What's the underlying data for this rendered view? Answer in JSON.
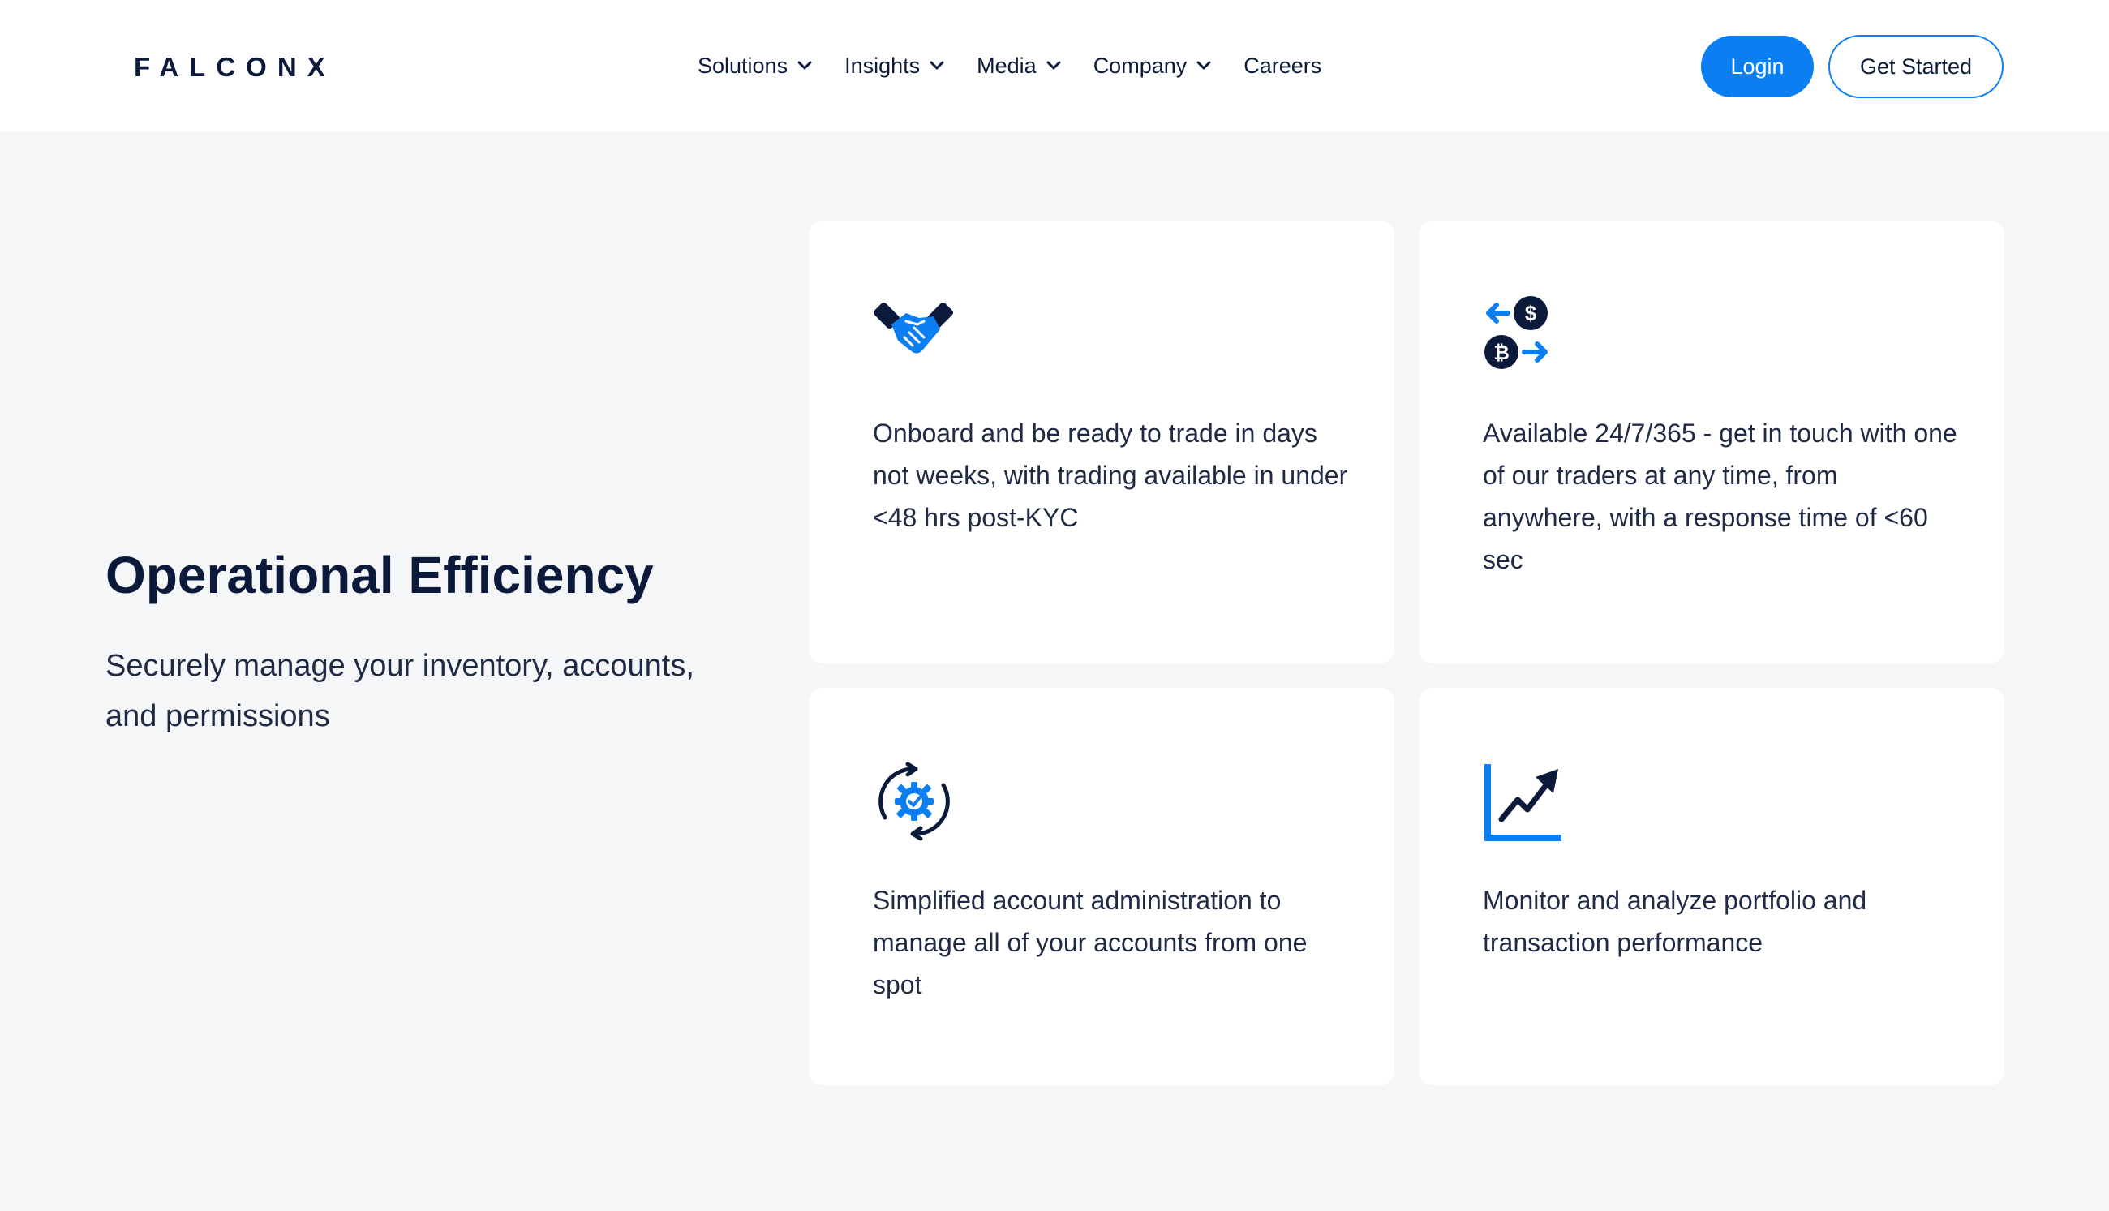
{
  "brand": {
    "logo_text": "FALCONX",
    "accent": "#0b7ff2",
    "navy": "#0b1a3a"
  },
  "nav": {
    "items": [
      {
        "label": "Solutions",
        "has_dropdown": true
      },
      {
        "label": "Insights",
        "has_dropdown": true
      },
      {
        "label": "Media",
        "has_dropdown": true
      },
      {
        "label": "Company",
        "has_dropdown": true
      },
      {
        "label": "Careers",
        "has_dropdown": false
      }
    ],
    "login_label": "Login",
    "get_started_label": "Get Started"
  },
  "hero": {
    "title": "Operational Efficiency",
    "subtitle": "Securely manage your inventory, accounts, and permissions"
  },
  "cards": [
    {
      "icon": "handshake-icon",
      "text": "Onboard and be ready to trade in days not weeks, with trading available in under <48 hrs post-KYC"
    },
    {
      "icon": "currency-exchange-icon",
      "text": "Available 24/7/365 - get in touch with one of our traders at any time, from anywhere, with a response time of <60 sec"
    },
    {
      "icon": "gear-sync-icon",
      "text": "Simplified account administration to manage all of your accounts from one spot"
    },
    {
      "icon": "growth-chart-icon",
      "text": "Monitor and analyze portfolio and transaction performance"
    }
  ]
}
